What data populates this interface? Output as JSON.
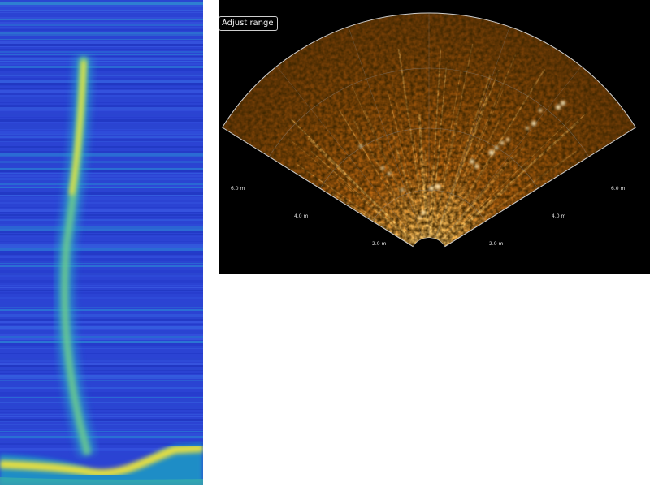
{
  "sonar": {
    "adjust_range_label": "Adjust range",
    "range_labels_left": [
      "2.0 m",
      "4.0 m",
      "6.0 m"
    ],
    "range_labels_right": [
      "2.0 m",
      "4.0 m",
      "6.0 m"
    ]
  },
  "colors": {
    "echogram_background": "#2a3fd6",
    "echogram_target": "#e9e236",
    "sonar_background": "#000000",
    "sonar_fan": "#c0700e",
    "sonar_bright": "#ffd27a",
    "sonar_grid": "#8a8a8a"
  }
}
